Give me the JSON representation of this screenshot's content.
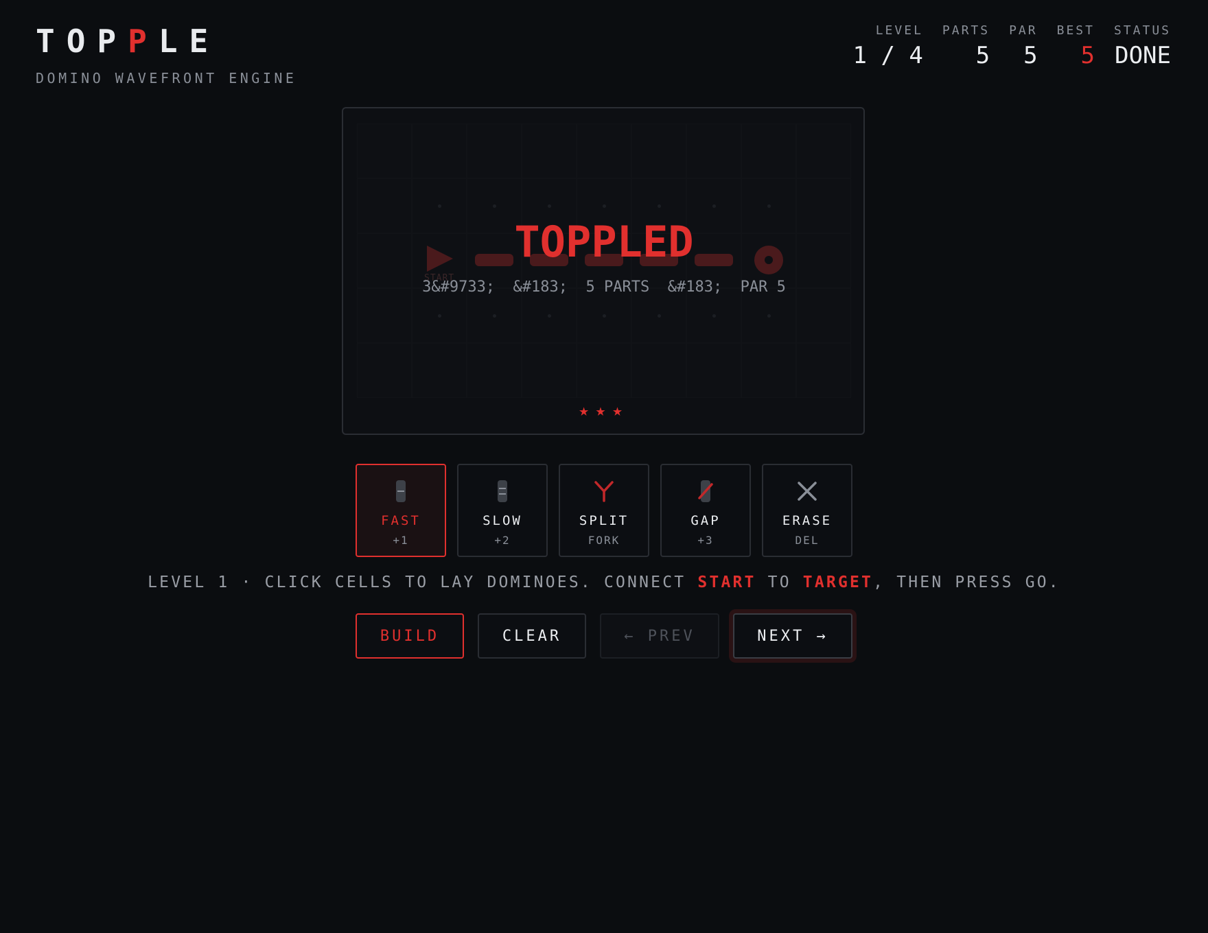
{
  "header": {
    "logo_letters": [
      "T",
      "O",
      "P",
      "P",
      "L",
      "E"
    ],
    "tagline": "DOMINO WAVEFRONT ENGINE"
  },
  "stats": [
    {
      "label": "LEVEL",
      "value": "1 / 4",
      "highlight": false
    },
    {
      "label": "PARTS",
      "value": "5",
      "highlight": false
    },
    {
      "label": "PAR",
      "value": "5",
      "highlight": false
    },
    {
      "label": "BEST",
      "value": "5",
      "highlight": true
    },
    {
      "label": "STATUS",
      "value": "DONE",
      "highlight": false
    }
  ],
  "board": {
    "columns": 9,
    "rows": 5,
    "start_label": "START",
    "overlay_title": "TOPPLED",
    "overlay_summary": "3&#9733;  &#183;  5 PARTS  &#183;  PAR 5",
    "stars": 3,
    "star_glyph": "★"
  },
  "tools": [
    {
      "name": "FAST",
      "sub": "+1",
      "icon": "fast-domino-icon",
      "active": true
    },
    {
      "name": "SLOW",
      "sub": "+2",
      "icon": "slow-domino-icon",
      "active": false
    },
    {
      "name": "SPLIT",
      "sub": "FORK",
      "icon": "split-fork-icon",
      "active": false
    },
    {
      "name": "GAP",
      "sub": "+3",
      "icon": "gap-domino-icon",
      "active": false
    },
    {
      "name": "ERASE",
      "sub": "DEL",
      "icon": "erase-x-icon",
      "active": false
    }
  ],
  "instruction": {
    "prefix": "LEVEL 1 · CLICK CELLS TO LAY DOMINOES. CONNECT ",
    "start": "START",
    "middle": " TO ",
    "target": "TARGET",
    "suffix": ", THEN PRESS GO."
  },
  "buttons": {
    "build": "BUILD",
    "clear": "CLEAR",
    "prev": "← PREV",
    "next": "NEXT →"
  },
  "colors": {
    "accent": "#e1302e",
    "background": "#0b0d10",
    "text": "#eceef1",
    "muted": "#8a8f98"
  }
}
